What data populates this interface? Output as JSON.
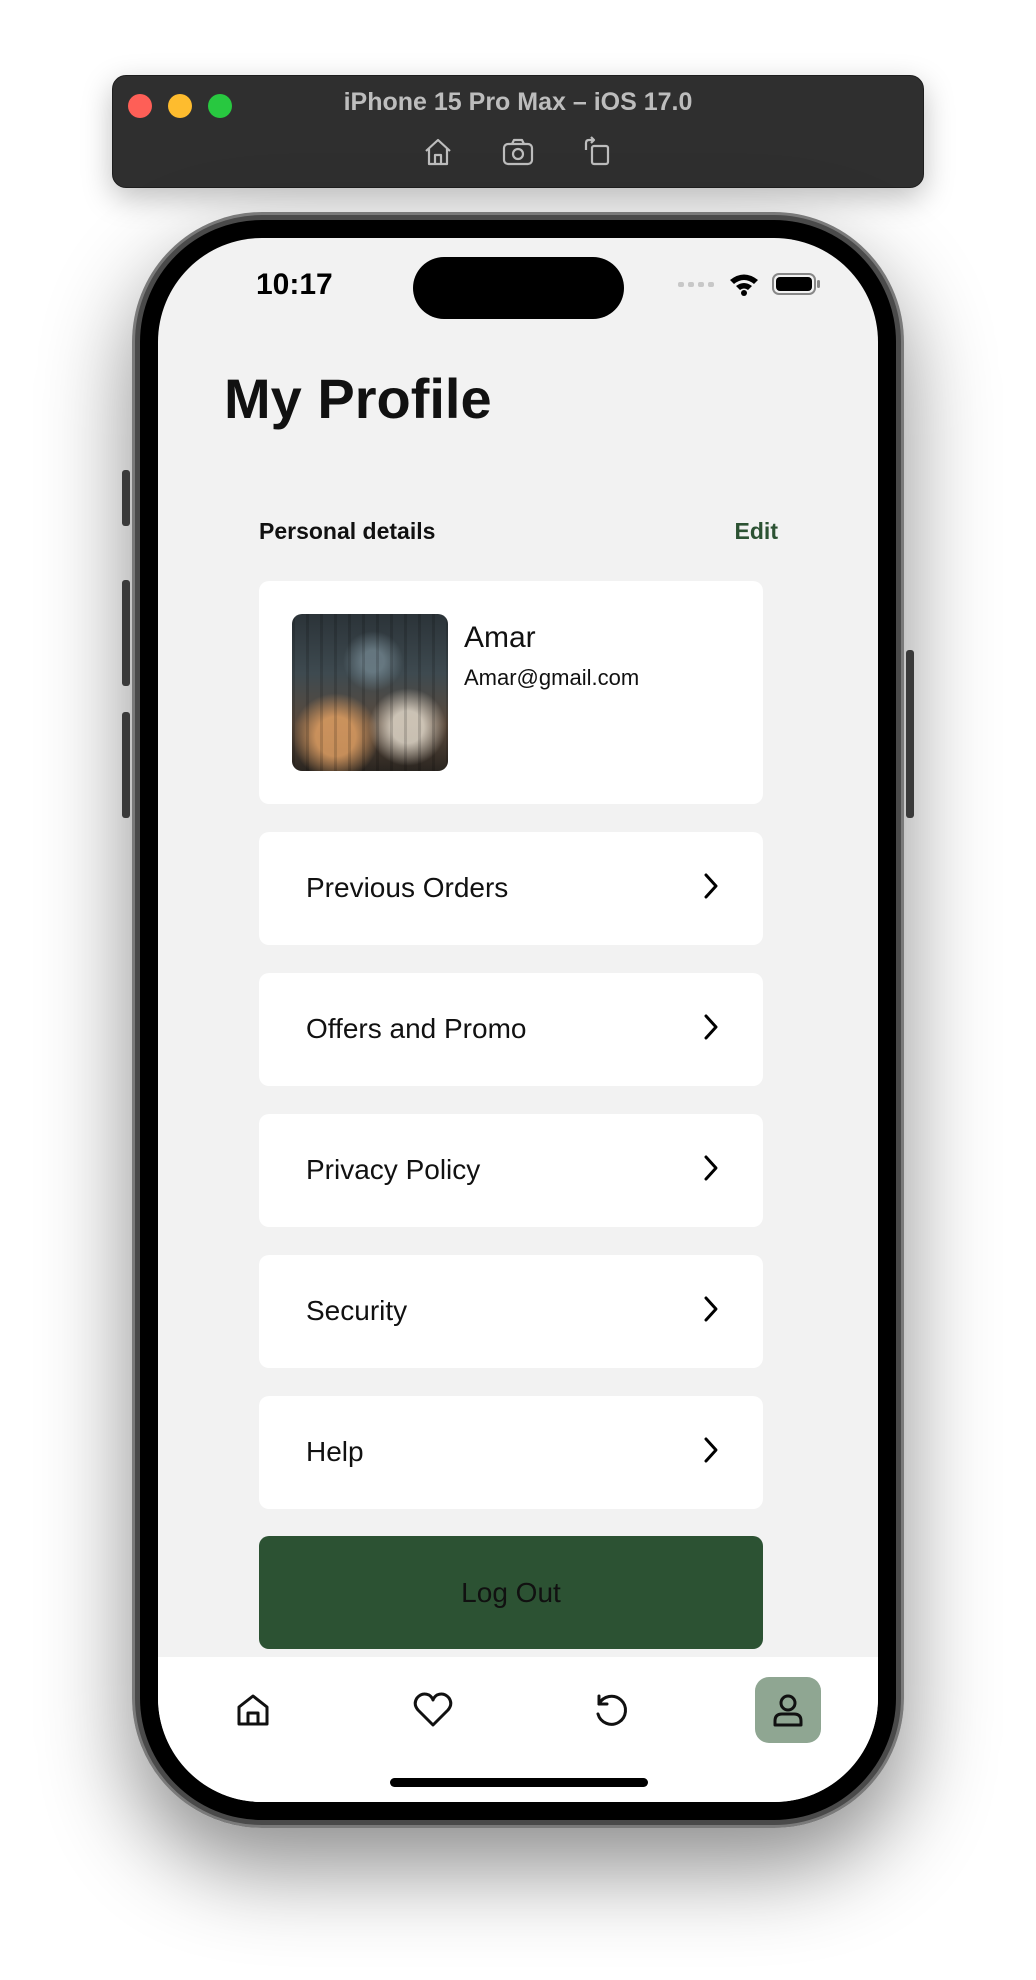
{
  "simulator": {
    "title": "iPhone 15 Pro Max – iOS 17.0",
    "tools": [
      "home-icon",
      "screenshot-icon",
      "rotate-icon"
    ]
  },
  "status_bar": {
    "time": "10:17",
    "icons": [
      "signal-icon",
      "wifi-icon",
      "battery-icon"
    ]
  },
  "page": {
    "title": "My Profile"
  },
  "personal_details": {
    "label": "Personal details",
    "edit_label": "Edit",
    "name": "Amar",
    "email": "Amar@gmail.com"
  },
  "menu": {
    "items": [
      {
        "label": "Previous Orders"
      },
      {
        "label": "Offers and Promo"
      },
      {
        "label": "Privacy Policy"
      },
      {
        "label": "Security"
      },
      {
        "label": "Help"
      }
    ]
  },
  "logout": {
    "label": "Log Out"
  },
  "tab_bar": {
    "tabs": [
      "home-icon",
      "heart-icon",
      "history-icon",
      "profile-icon"
    ],
    "active": "profile-icon"
  },
  "colors": {
    "accent": "#2c5233",
    "active_tab": "#8fa692",
    "background": "#f2f2f2"
  }
}
